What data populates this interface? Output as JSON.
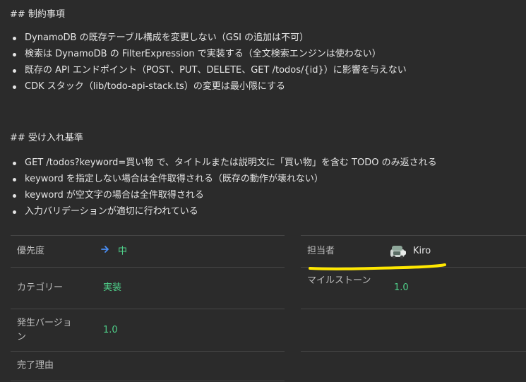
{
  "constraints": {
    "heading": "## 制約事項",
    "items": [
      "DynamoDB の既存テーブル構成を変更しない（GSI の追加は不可）",
      "検索は DynamoDB の FilterExpression で実装する（全文検索エンジンは使わない）",
      "既存の API エンドポイント（POST、PUT、DELETE、GET /todos/{id}）に影響を与えない",
      "CDK スタック（lib/todo-api-stack.ts）の変更は最小限にする"
    ]
  },
  "acceptance": {
    "heading": "## 受け入れ基準",
    "items": [
      "GET /todos?keyword=買い物 で、タイトルまたは説明文に「買い物」を含む TODO のみ返される",
      "keyword を指定しない場合は全件取得される（既存の動作が壊れない）",
      "keyword が空文字の場合は全件取得される",
      "入力バリデーションが適切に行われている"
    ]
  },
  "properties": {
    "priority": {
      "label": "優先度",
      "value": "中",
      "icon": "arrow-right-icon"
    },
    "assignee": {
      "label": "担当者",
      "value": "Kiro",
      "icon": "avatar-icon"
    },
    "category": {
      "label": "カテゴリー",
      "value": "実装"
    },
    "milestone": {
      "label": "マイルストーン",
      "value": "1.0"
    },
    "version": {
      "label": "発生バージョン",
      "value": "1.0"
    },
    "resolution": {
      "label": "完了理由",
      "value": ""
    }
  },
  "colors": {
    "background": "#2b2b2b",
    "value_green": "#4fd08a",
    "arrow_blue": "#4a8ef5",
    "highlight_yellow": "#ffe800"
  }
}
